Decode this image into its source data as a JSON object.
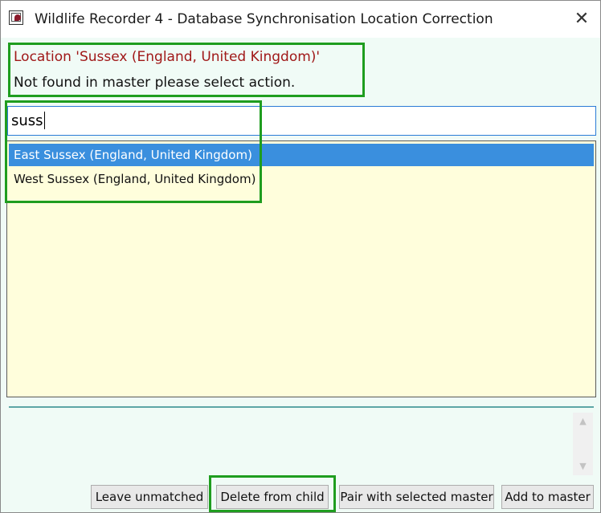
{
  "window": {
    "title": "Wildlife Recorder 4 - Database Synchronisation Location Correction",
    "close_glyph": "✕"
  },
  "header": {
    "location_line": "Location 'Sussex (England, United Kingdom)'",
    "instruction_line": "Not found in master please select action."
  },
  "search": {
    "value": "suss"
  },
  "results": {
    "items": [
      {
        "label": "East Sussex (England, United Kingdom)",
        "selected": true
      },
      {
        "label": "West Sussex (England, United Kingdom)",
        "selected": false
      }
    ]
  },
  "memo": {
    "scroll_up_glyph": "▲",
    "scroll_down_glyph": "▼"
  },
  "buttons": {
    "leave_unmatched": "Leave unmatched",
    "delete_from_child": "Delete from child",
    "pair_with_selected_master": "Pair with selected master",
    "add_to_master": "Add to master"
  },
  "colors": {
    "highlight_box": "#1f9d1f",
    "selection": "#3a8fde",
    "list_background": "#fffedc",
    "location_text": "#a01818"
  }
}
